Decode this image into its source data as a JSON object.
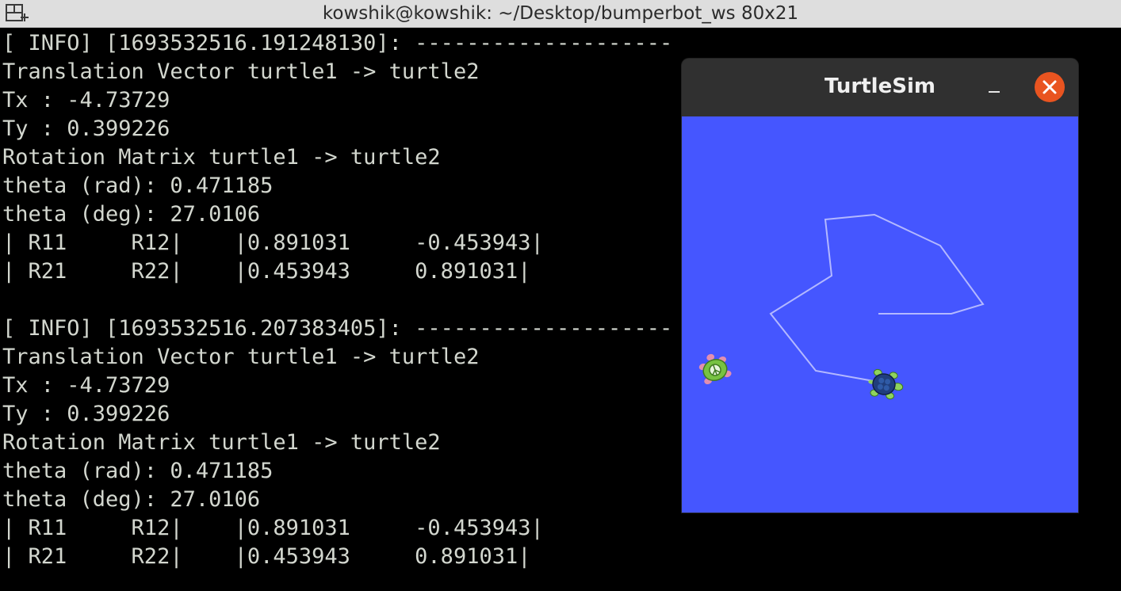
{
  "terminal": {
    "title": "kowshik@kowshik: ~/Desktop/bumperbot_ws 80x21",
    "lines": [
      "[ INFO] [1693532516.191248130]: --------------------",
      "Translation Vector turtle1 -> turtle2",
      "Tx : -4.73729",
      "Ty : 0.399226",
      "Rotation Matrix turtle1 -> turtle2",
      "theta (rad): 0.471185",
      "theta (deg): 27.0106",
      "| R11     R12|    |0.891031     -0.453943|",
      "| R21     R22|    |0.453943     0.891031|",
      "",
      "[ INFO] [1693532516.207383405]: --------------------",
      "Translation Vector turtle1 -> turtle2",
      "Tx : -4.73729",
      "Ty : 0.399226",
      "Rotation Matrix turtle1 -> turtle2",
      "theta (rad): 0.471185",
      "theta (deg): 27.0106",
      "| R11     R12|    |0.891031     -0.453943|",
      "| R21     R22|    |0.453943     0.891031|"
    ]
  },
  "turtlesim": {
    "title": "TurtleSim",
    "background_color": "#4556ff",
    "pen_color": "#b3b8ff",
    "close_color": "#e95420"
  },
  "icons": {
    "tab": "new-tab-icon",
    "minimize": "minimize-icon",
    "close": "close-icon"
  }
}
